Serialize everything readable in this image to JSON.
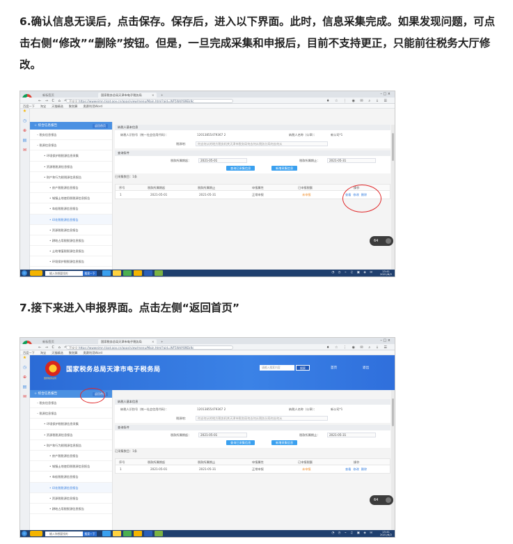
{
  "step6": {
    "instruction": "6.确认信息无误后，点击保存。保存后，进入以下界面。此时，信息采集完成。如果发现问题，可点击右侧“修改”“删除”按钮。但是，一旦完成采集和申报后，目前不支持更正，只能前往税务大厅修改。"
  },
  "step7": {
    "instruction": "7.接下来进入申报界面。点击左侧“返回首页”"
  },
  "browser": {
    "tab1": "新标签页",
    "tab2": "国家税务总局天津市电子税务局",
    "tab_close": "×",
    "tab_new": "+",
    "window_controls": "–  □  ×",
    "nav_glyphs": "← → C ⌂ ↶ ☆",
    "security_label": "不安全",
    "url": "https://wwwejmn.tjsat.gov.cn/apps/view/menu/Main.html?aid=WF5WdY89Ek9c",
    "right_glyphs": "♦ ☆ ⋮  ◉ ✉ ⌕ ↓ ☰",
    "bookmarks": [
      "百度一下",
      "淘宝",
      "天猫精选",
      "聚划算",
      "奥赛利用Word"
    ]
  },
  "side_strip_icons": [
    "★",
    "◷",
    "⊕",
    "▤",
    "✉"
  ],
  "sidebar": {
    "header": "综合信息报告",
    "back_home": "返回首页",
    "items_step6": [
      {
        "label": "税务信息报告",
        "level": "top",
        "active": false
      },
      {
        "label": "税源信息报告",
        "level": "top",
        "active": false
      },
      {
        "label": "环境保护税税源信息采集",
        "level": "sub",
        "active": false
      },
      {
        "label": "资源税税源信息报告",
        "level": "sub",
        "active": false
      },
      {
        "label": "财产和行为税税源信息报告",
        "level": "sub",
        "active": false
      },
      {
        "label": "房产税税源信息报告",
        "level": "sub2",
        "active": false
      },
      {
        "label": "城镇土地使用税税源信息报告",
        "level": "sub2",
        "active": false
      },
      {
        "label": "车船税税源信息报告",
        "level": "sub2",
        "active": false
      },
      {
        "label": "印花税税源信息报告",
        "level": "sub2",
        "active": true
      },
      {
        "label": "资源税税源信息报告",
        "level": "sub2",
        "active": false
      },
      {
        "label": "耕地占用税税源信息报告",
        "level": "sub2",
        "active": false
      },
      {
        "label": "土地增值税税源信息报告",
        "level": "sub2",
        "active": false
      },
      {
        "label": "环境保护税税源信息报告",
        "level": "sub2",
        "active": false
      }
    ],
    "items_step7": [
      {
        "label": "税务信息报告",
        "level": "top",
        "active": false
      },
      {
        "label": "税源信息报告",
        "level": "top",
        "active": false
      },
      {
        "label": "环境保护税税源信息采集",
        "level": "sub",
        "active": false
      },
      {
        "label": "资源税税源信息报告",
        "level": "sub",
        "active": false
      },
      {
        "label": "财产和行为税税源信息报告",
        "level": "sub",
        "active": false
      },
      {
        "label": "房产税税源信息报告",
        "level": "sub2",
        "active": false
      },
      {
        "label": "城镇土地使用税税源信息报告",
        "level": "sub2",
        "active": false
      },
      {
        "label": "车船税税源信息报告",
        "level": "sub2",
        "active": false
      },
      {
        "label": "印花税税源信息报告",
        "level": "sub2",
        "active": true
      },
      {
        "label": "资源税税源信息报告",
        "level": "sub2",
        "active": false
      },
      {
        "label": "耕地占用税税源信息报告",
        "level": "sub2",
        "active": false
      }
    ]
  },
  "form": {
    "section_basic": "纳税人基本信息",
    "taxpayer_id_label": "纳税人识别号（统一社会信用代码）：",
    "taxpayer_id_value": "12013855479367 2",
    "taxpayer_name_label": "纳税人名称（公章）：",
    "taxpayer_name_value": "新公司*1",
    "tax_item_label": "税源地：",
    "tax_item_value": "何去何从的地方税务机关天津市税务局何去何从税务分局何去何从",
    "section_query": "查询条件",
    "period_start_label": "税款所属期起：",
    "period_start_value": "2021-05-01",
    "period_end_label": "税款所属期止：",
    "period_end_value": "2021-05-31",
    "btn_query": "查询已采集信息",
    "btn_new": "新增采集信息",
    "collected_count": "已采集数目：1条"
  },
  "table": {
    "headers": [
      "序号",
      "税款所属期起",
      "税款所属期止",
      "申报属性",
      "已申报税额",
      "操作"
    ],
    "rows": [
      {
        "no": "1",
        "start": "2021-05-01",
        "end": "2021-05-31",
        "attr": "正常申报",
        "status": "未申报",
        "ops": [
          "查看",
          "修改",
          "删除"
        ]
      }
    ]
  },
  "banner": {
    "title": "国家税务总局天津市电子税务局",
    "emblem_caption": "国家税务总局",
    "search_placeholder": "请输入搜索内容",
    "search_button": "搜索",
    "nav_home": "首页",
    "nav_exit": "退出"
  },
  "zoom": "64",
  "taskbar": {
    "search_placeholder": "输入你想要找的",
    "search_button": "搜索一下",
    "tray": "◔ ◷ ⌁ ♫ ▣ ◈ ✉",
    "time_6": "13:41",
    "date_6": "2021/6/2",
    "time_7": "13:41",
    "date_7": "2021/6/2"
  },
  "colors": {
    "accent_blue": "#3aa0ef",
    "sidebar_header": "#4a90e2",
    "banner_blue": "#2b6bd6",
    "annotation_red": "#e0282a",
    "status_orange": "#f08a24"
  }
}
